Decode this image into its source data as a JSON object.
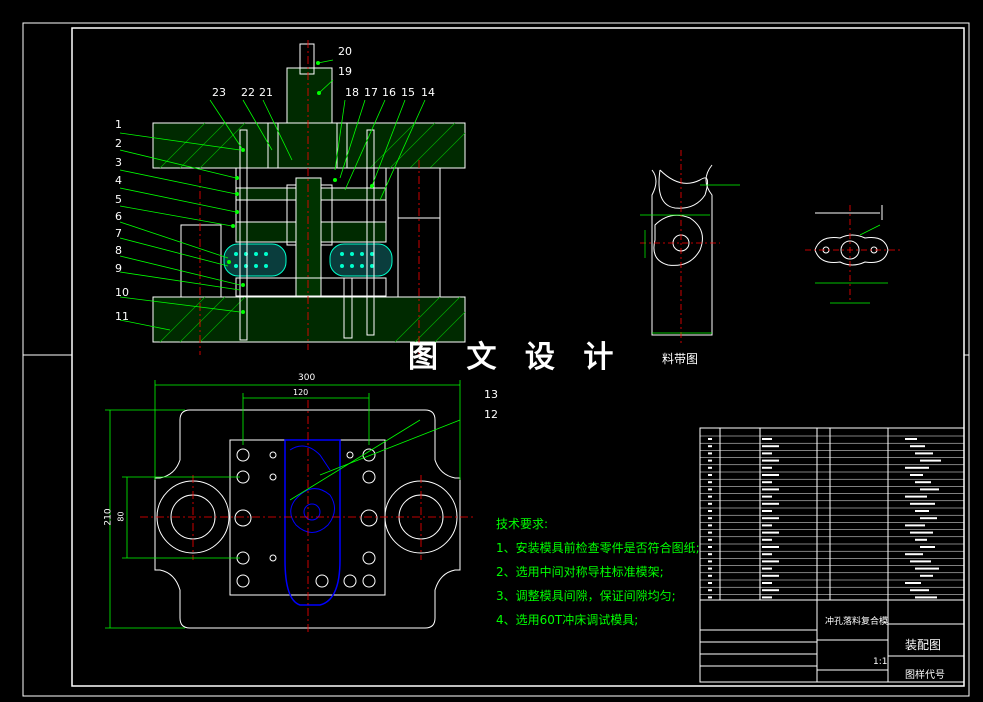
{
  "watermark": "图 文 设 计",
  "strip_title": "料带图",
  "tech": {
    "heading": "技术要求:",
    "items": [
      "1、安装模具前检查零件是否符合图纸;",
      "2、选用中间对称导柱标准模架;",
      "3、调整模具间隙，保证间隙均匀;",
      "4、选用60T冲床调试模具;"
    ]
  },
  "callouts_left": [
    "1",
    "2",
    "3",
    "4",
    "5",
    "6",
    "7",
    "8",
    "9",
    "10",
    "11"
  ],
  "callouts_top": [
    "23",
    "22",
    "21",
    "20",
    "19",
    "18",
    "17",
    "16",
    "15",
    "14"
  ],
  "callouts_right": [
    "13",
    "12"
  ],
  "dims": {
    "w300": "300",
    "w120": "120",
    "h210": "210",
    "h80": "80"
  },
  "title_block": {
    "part_name": "冲孔落料复合模",
    "drawing_type": "装配图",
    "drawing_code": "图样代号",
    "scale": "1:1"
  },
  "colors": {
    "line": "#ffffff",
    "dim": "#00ff00",
    "hatch": "#00aa00",
    "center": "#ff0000",
    "part": "#0000ff",
    "spring": "#00ffcc"
  }
}
